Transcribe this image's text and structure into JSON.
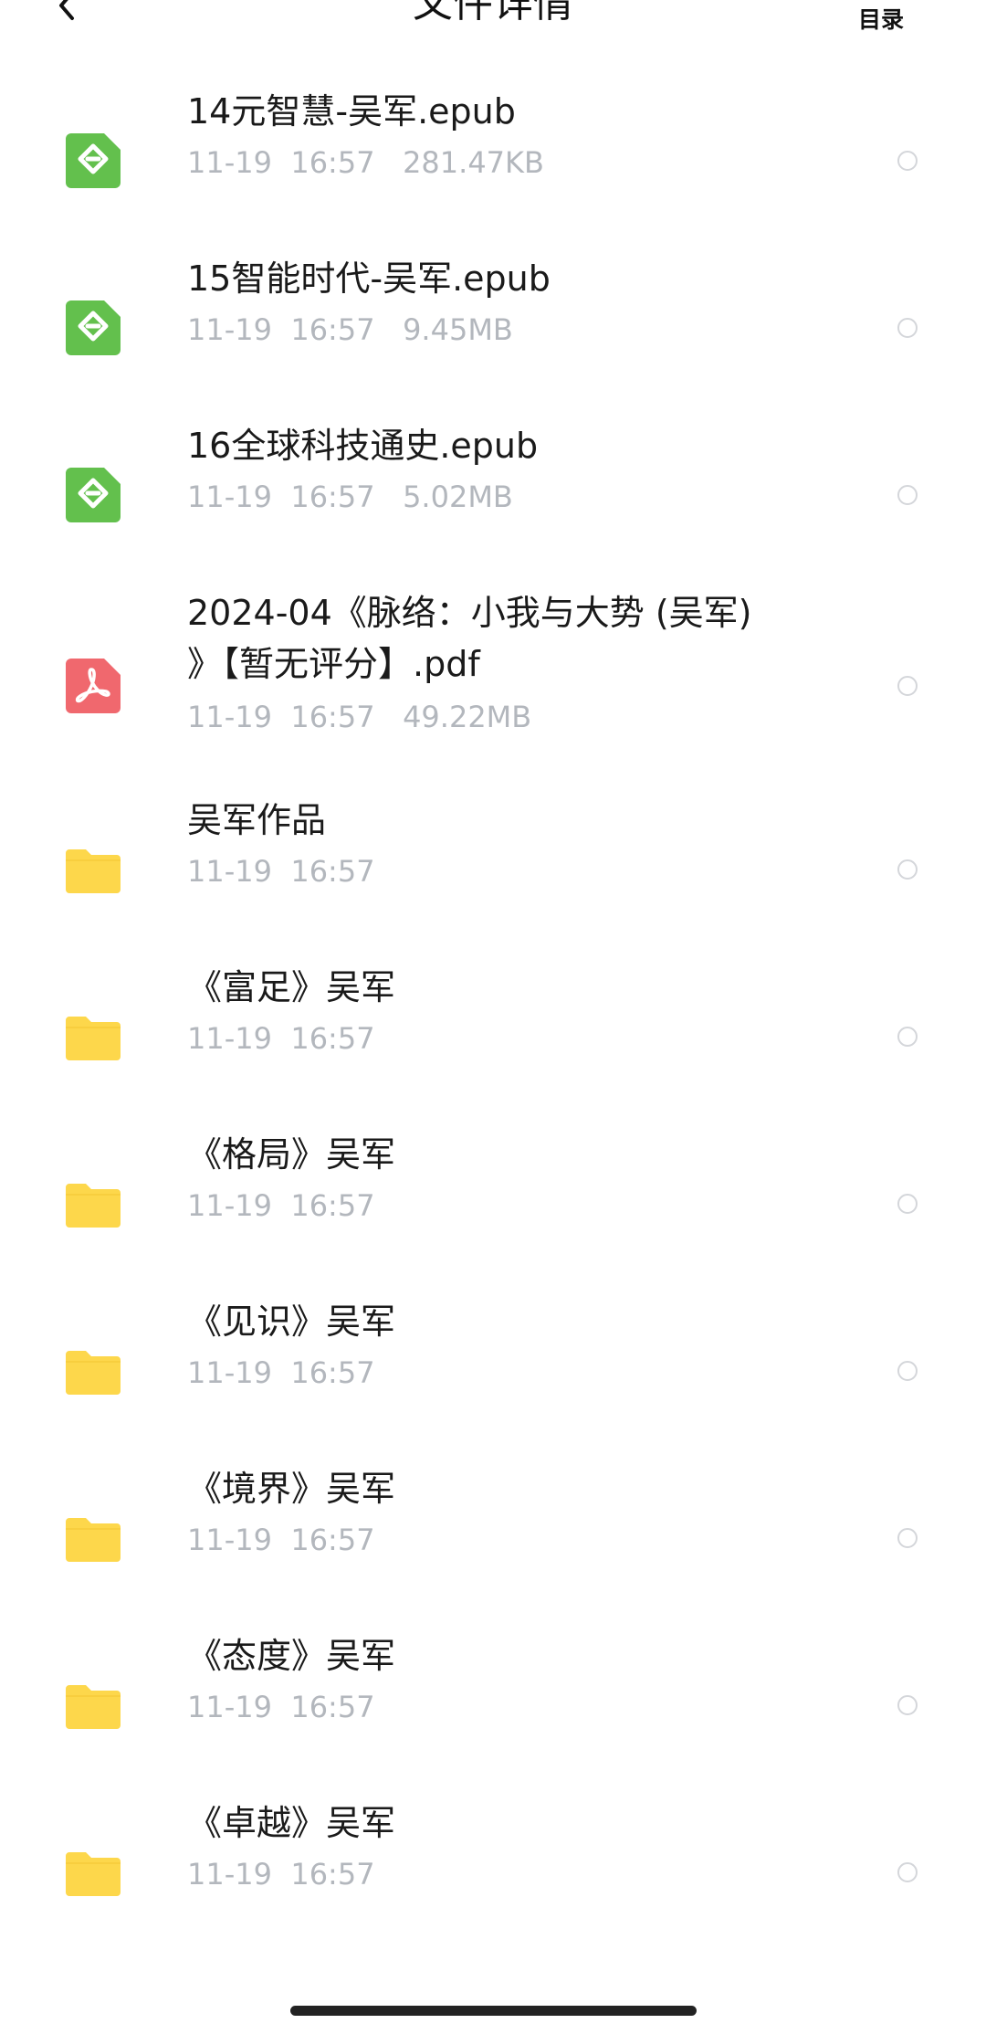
{
  "header": {
    "title": "文件详情",
    "toc_label": "目录"
  },
  "colors": {
    "epub_green": "#63c04d",
    "pdf_red": "#f0686e",
    "folder_yellow": "#fdd74b",
    "meta_gray": "#b3b7bd"
  },
  "files": [
    {
      "icon": "epub-icon",
      "name": "14元智慧-吴军.epub",
      "meta": "11-19  16:57   281.47KB"
    },
    {
      "icon": "epub-icon",
      "name": "15智能时代-吴军.epub",
      "meta": "11-19  16:57   9.45MB"
    },
    {
      "icon": "epub-icon",
      "name": "16全球科技通史.epub",
      "meta": "11-19  16:57   5.02MB"
    },
    {
      "icon": "pdf-icon",
      "name": "2024-04《脉络：小我与大势 (吴军) 》【暂无评分】.pdf",
      "meta": "11-19  16:57   49.22MB"
    },
    {
      "icon": "folder-icon",
      "name": "吴军作品",
      "meta": "11-19  16:57"
    },
    {
      "icon": "folder-icon",
      "name": "《富足》吴军",
      "meta": "11-19  16:57"
    },
    {
      "icon": "folder-icon",
      "name": "《格局》吴军",
      "meta": "11-19  16:57"
    },
    {
      "icon": "folder-icon",
      "name": "《见识》吴军",
      "meta": "11-19  16:57"
    },
    {
      "icon": "folder-icon",
      "name": "《境界》吴军",
      "meta": "11-19  16:57"
    },
    {
      "icon": "folder-icon",
      "name": "《态度》吴军",
      "meta": "11-19  16:57"
    },
    {
      "icon": "folder-icon",
      "name": "《卓越》吴军",
      "meta": "11-19  16:57"
    }
  ]
}
